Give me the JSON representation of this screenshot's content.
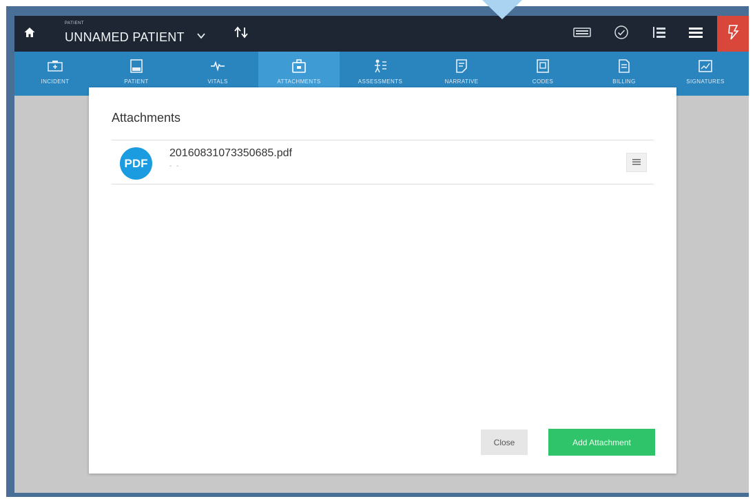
{
  "topbar": {
    "patient_caption": "PATIENT",
    "patient_name": "UNNAMED PATIENT",
    "icons": [
      "home-icon",
      "chevron-down-icon",
      "sort-icon",
      "keyboard-icon",
      "check-circle-icon",
      "list-icon",
      "menu-icon",
      "alert-icon"
    ],
    "alert_color": "#d9473b",
    "bar_color": "#1d2632"
  },
  "nav": {
    "accent": "#2a85be",
    "active_tab": "ATTACHMENTS",
    "tabs": [
      {
        "label": "INCIDENT",
        "icon": "ambulance-icon"
      },
      {
        "label": "PATIENT",
        "icon": "patient-icon"
      },
      {
        "label": "VITALS",
        "icon": "heartbeat-icon"
      },
      {
        "label": "ATTACHMENTS",
        "icon": "briefcase-icon"
      },
      {
        "label": "ASSESSMENTS",
        "icon": "assessment-icon"
      },
      {
        "label": "NARRATIVE",
        "icon": "narrative-icon"
      },
      {
        "label": "CODES",
        "icon": "codes-icon"
      },
      {
        "label": "BILLING",
        "icon": "billing-icon"
      },
      {
        "label": "SIGNATURES",
        "icon": "signature-icon"
      }
    ]
  },
  "modal": {
    "title": "Attachments",
    "attachments": [
      {
        "badge": "PDF",
        "filename": "20160831073350685.pdf",
        "subtitle": "- -"
      }
    ],
    "close_label": "Close",
    "add_label": "Add Attachment",
    "add_color": "#2fc46a"
  }
}
